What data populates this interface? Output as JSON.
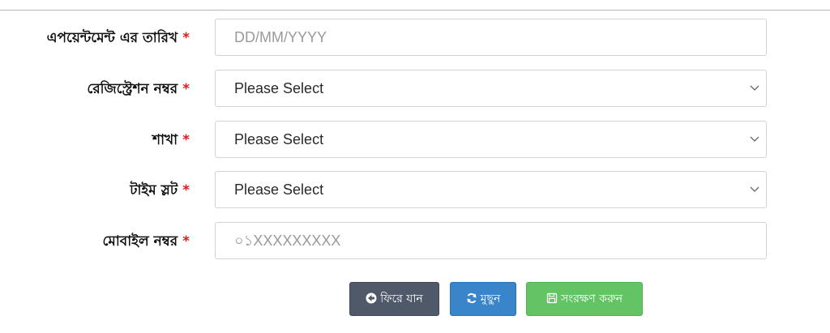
{
  "form": {
    "appointment_date": {
      "label": "এপয়েন্টমেন্ট এর তারিখ",
      "required_mark": "*",
      "placeholder": "DD/MM/YYYY"
    },
    "registration_no": {
      "label": "রেজিস্ট্রেশন নম্বর",
      "required_mark": "*",
      "selected": "Please Select"
    },
    "branch": {
      "label": "শাখা",
      "required_mark": "*",
      "selected": "Please Select"
    },
    "time_slot": {
      "label": "টাইম স্লট",
      "required_mark": "*",
      "selected": "Please Select"
    },
    "mobile_no": {
      "label": "মোবাইল নম্বর",
      "required_mark": "*",
      "placeholder": "০১XXXXXXXXX"
    }
  },
  "actions": {
    "back_label": "ফিরে যান",
    "reset_label": "মুছুন",
    "save_label": "সংরক্ষণ করুন"
  },
  "colors": {
    "required": "#dd1c1c",
    "back_button": "#50596a",
    "reset_button": "#3a85c9",
    "save_button": "#62c462"
  },
  "icons": {
    "back": "arrow-circle-left-icon",
    "reset": "refresh-icon",
    "save": "floppy-disk-icon",
    "select": "chevron-down-icon"
  }
}
